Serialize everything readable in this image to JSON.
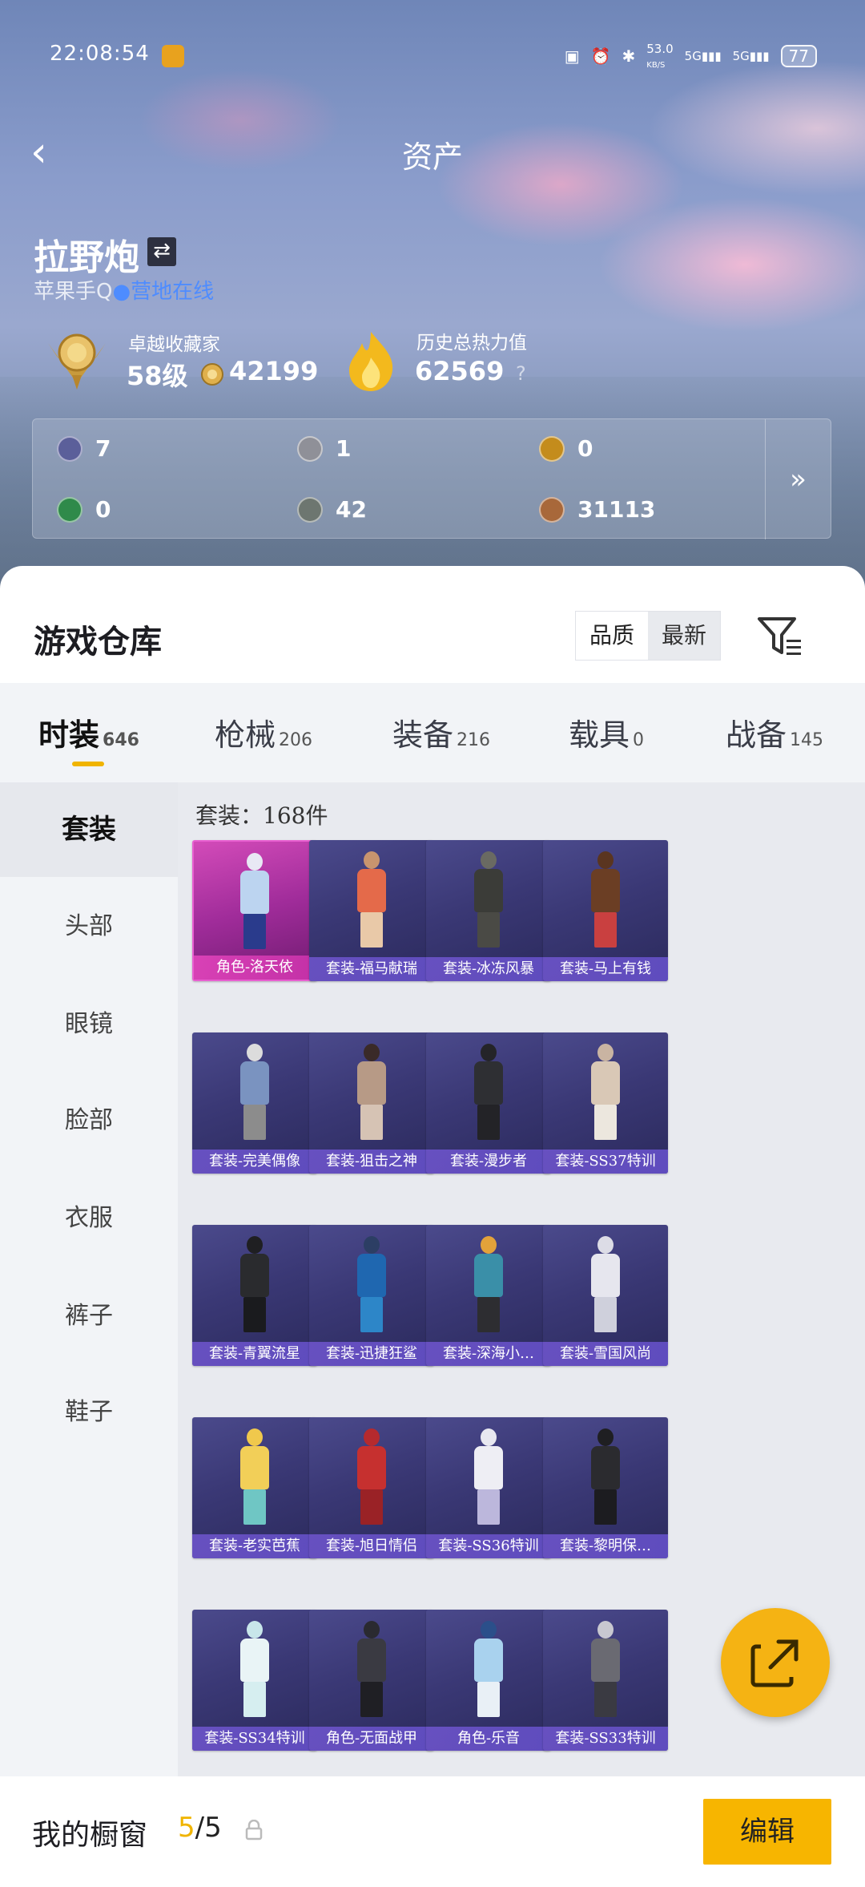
{
  "status_bar": {
    "time": "22:08:54",
    "net_speed": "53.0",
    "net_unit": "KB/S",
    "sig1": "5G",
    "sig2": "5G",
    "battery": "77"
  },
  "header": {
    "title": "资产"
  },
  "user": {
    "name": "拉野炮",
    "subtitle_prefix": "苹果手Q",
    "online_status": "营地在线"
  },
  "rank": {
    "label": "卓越收藏家",
    "level": "58级",
    "points": "42199"
  },
  "heat": {
    "label": "历史总热力值",
    "value": "62569",
    "help": "?"
  },
  "stats": [
    {
      "icon": "purple-card-icon",
      "value": "7",
      "color": "#5b5f9a"
    },
    {
      "icon": "silver-coin-icon",
      "value": "1",
      "color": "#8f9098"
    },
    {
      "icon": "gold-coin-icon",
      "value": "0",
      "color": "#c48c1c"
    },
    {
      "icon": "green-card-icon",
      "value": "0",
      "color": "#2f8a4a"
    },
    {
      "icon": "grey-orb-icon",
      "value": "42",
      "color": "#6d7670"
    },
    {
      "icon": "bronze-orb-icon",
      "value": "31113",
      "color": "#a8683a"
    }
  ],
  "stats_more": "»",
  "warehouse": {
    "title": "游戏仓库",
    "sort_quality": "品质",
    "sort_newest": "最新",
    "tabs": [
      {
        "label": "时装",
        "count": "646"
      },
      {
        "label": "枪械",
        "count": "206"
      },
      {
        "label": "装备",
        "count": "216"
      },
      {
        "label": "载具",
        "count": "0"
      },
      {
        "label": "战备",
        "count": "145"
      }
    ],
    "categories": [
      "套装",
      "头部",
      "眼镜",
      "脸部",
      "衣服",
      "裤子",
      "鞋子"
    ],
    "grid_header": "套装：168件",
    "items": [
      {
        "label": "角色-洛天依",
        "rarity": "legend",
        "c1": "#e8e8f4",
        "c2": "#bcd4f0",
        "c3": "#2a3b8c"
      },
      {
        "label": "套装-福马献瑞",
        "rarity": "normal",
        "c1": "#c8946e",
        "c2": "#e46a4a",
        "c3": "#e9c9a8"
      },
      {
        "label": "套装-冰冻风暴",
        "rarity": "normal",
        "c1": "#6a6a62",
        "c2": "#3b3c38",
        "c3": "#4a4a45"
      },
      {
        "label": "套装-马上有钱",
        "rarity": "normal",
        "c1": "#5a3520",
        "c2": "#6b3e24",
        "c3": "#c94040"
      },
      {
        "label": "套装-完美偶像",
        "rarity": "normal",
        "c1": "#dcdcdc",
        "c2": "#7a93c0",
        "c3": "#8c8c8c"
      },
      {
        "label": "套装-狙击之神",
        "rarity": "normal",
        "c1": "#3a2a28",
        "c2": "#b79a86",
        "c3": "#d6c3b4"
      },
      {
        "label": "套装-漫步者",
        "rarity": "normal",
        "c1": "#242428",
        "c2": "#2e2f33",
        "c3": "#232327"
      },
      {
        "label": "套装-SS37特训",
        "rarity": "normal",
        "c1": "#c9b4a2",
        "c2": "#d9c8b6",
        "c3": "#ece7de"
      },
      {
        "label": "套装-青翼流星",
        "rarity": "normal",
        "c1": "#1f1f22",
        "c2": "#2a2b2e",
        "c3": "#1a1b1e"
      },
      {
        "label": "套装-迅捷狂鲨",
        "rarity": "normal",
        "c1": "#2c3e64",
        "c2": "#1f67b0",
        "c3": "#2d86c8"
      },
      {
        "label": "套装-深海小…",
        "rarity": "normal",
        "c1": "#e3a23a",
        "c2": "#3a8fa8",
        "c3": "#2d2d31"
      },
      {
        "label": "套装-雪国风尚",
        "rarity": "normal",
        "c1": "#dcdce6",
        "c2": "#e6e6ee",
        "c3": "#cfd0dc"
      },
      {
        "label": "套装-老实芭蕉",
        "rarity": "normal",
        "c1": "#f0c84c",
        "c2": "#f2cf58",
        "c3": "#6fc6c4"
      },
      {
        "label": "套装-旭日情侣",
        "rarity": "normal",
        "c1": "#b52a2e",
        "c2": "#c6302f",
        "c3": "#9a2226"
      },
      {
        "label": "套装-SS36特训",
        "rarity": "normal",
        "c1": "#e8e8f0",
        "c2": "#eeeef4",
        "c3": "#bcb7dc"
      },
      {
        "label": "套装-黎明保…",
        "rarity": "normal",
        "c1": "#1f1f22",
        "c2": "#2b2b2f",
        "c3": "#1c1c20"
      },
      {
        "label": "套装-SS34特训",
        "rarity": "normal",
        "c1": "#c8e6ea",
        "c2": "#e9f4f6",
        "c3": "#d6eef0"
      },
      {
        "label": "角色-无面战甲",
        "rarity": "normal",
        "c1": "#2a2a30",
        "c2": "#3a3a42",
        "c3": "#1f1f24"
      },
      {
        "label": "角色-乐音",
        "rarity": "normal",
        "c1": "#2b4f8a",
        "c2": "#a9d2ee",
        "c3": "#e9f0f6"
      },
      {
        "label": "套装-SS33特训",
        "rarity": "normal",
        "c1": "#c8c8d0",
        "c2": "#6a6a72",
        "c3": "#3a3a42"
      }
    ]
  },
  "showcase": {
    "label": "我的橱窗",
    "current": "5",
    "total": "/5",
    "edit": "编辑"
  }
}
